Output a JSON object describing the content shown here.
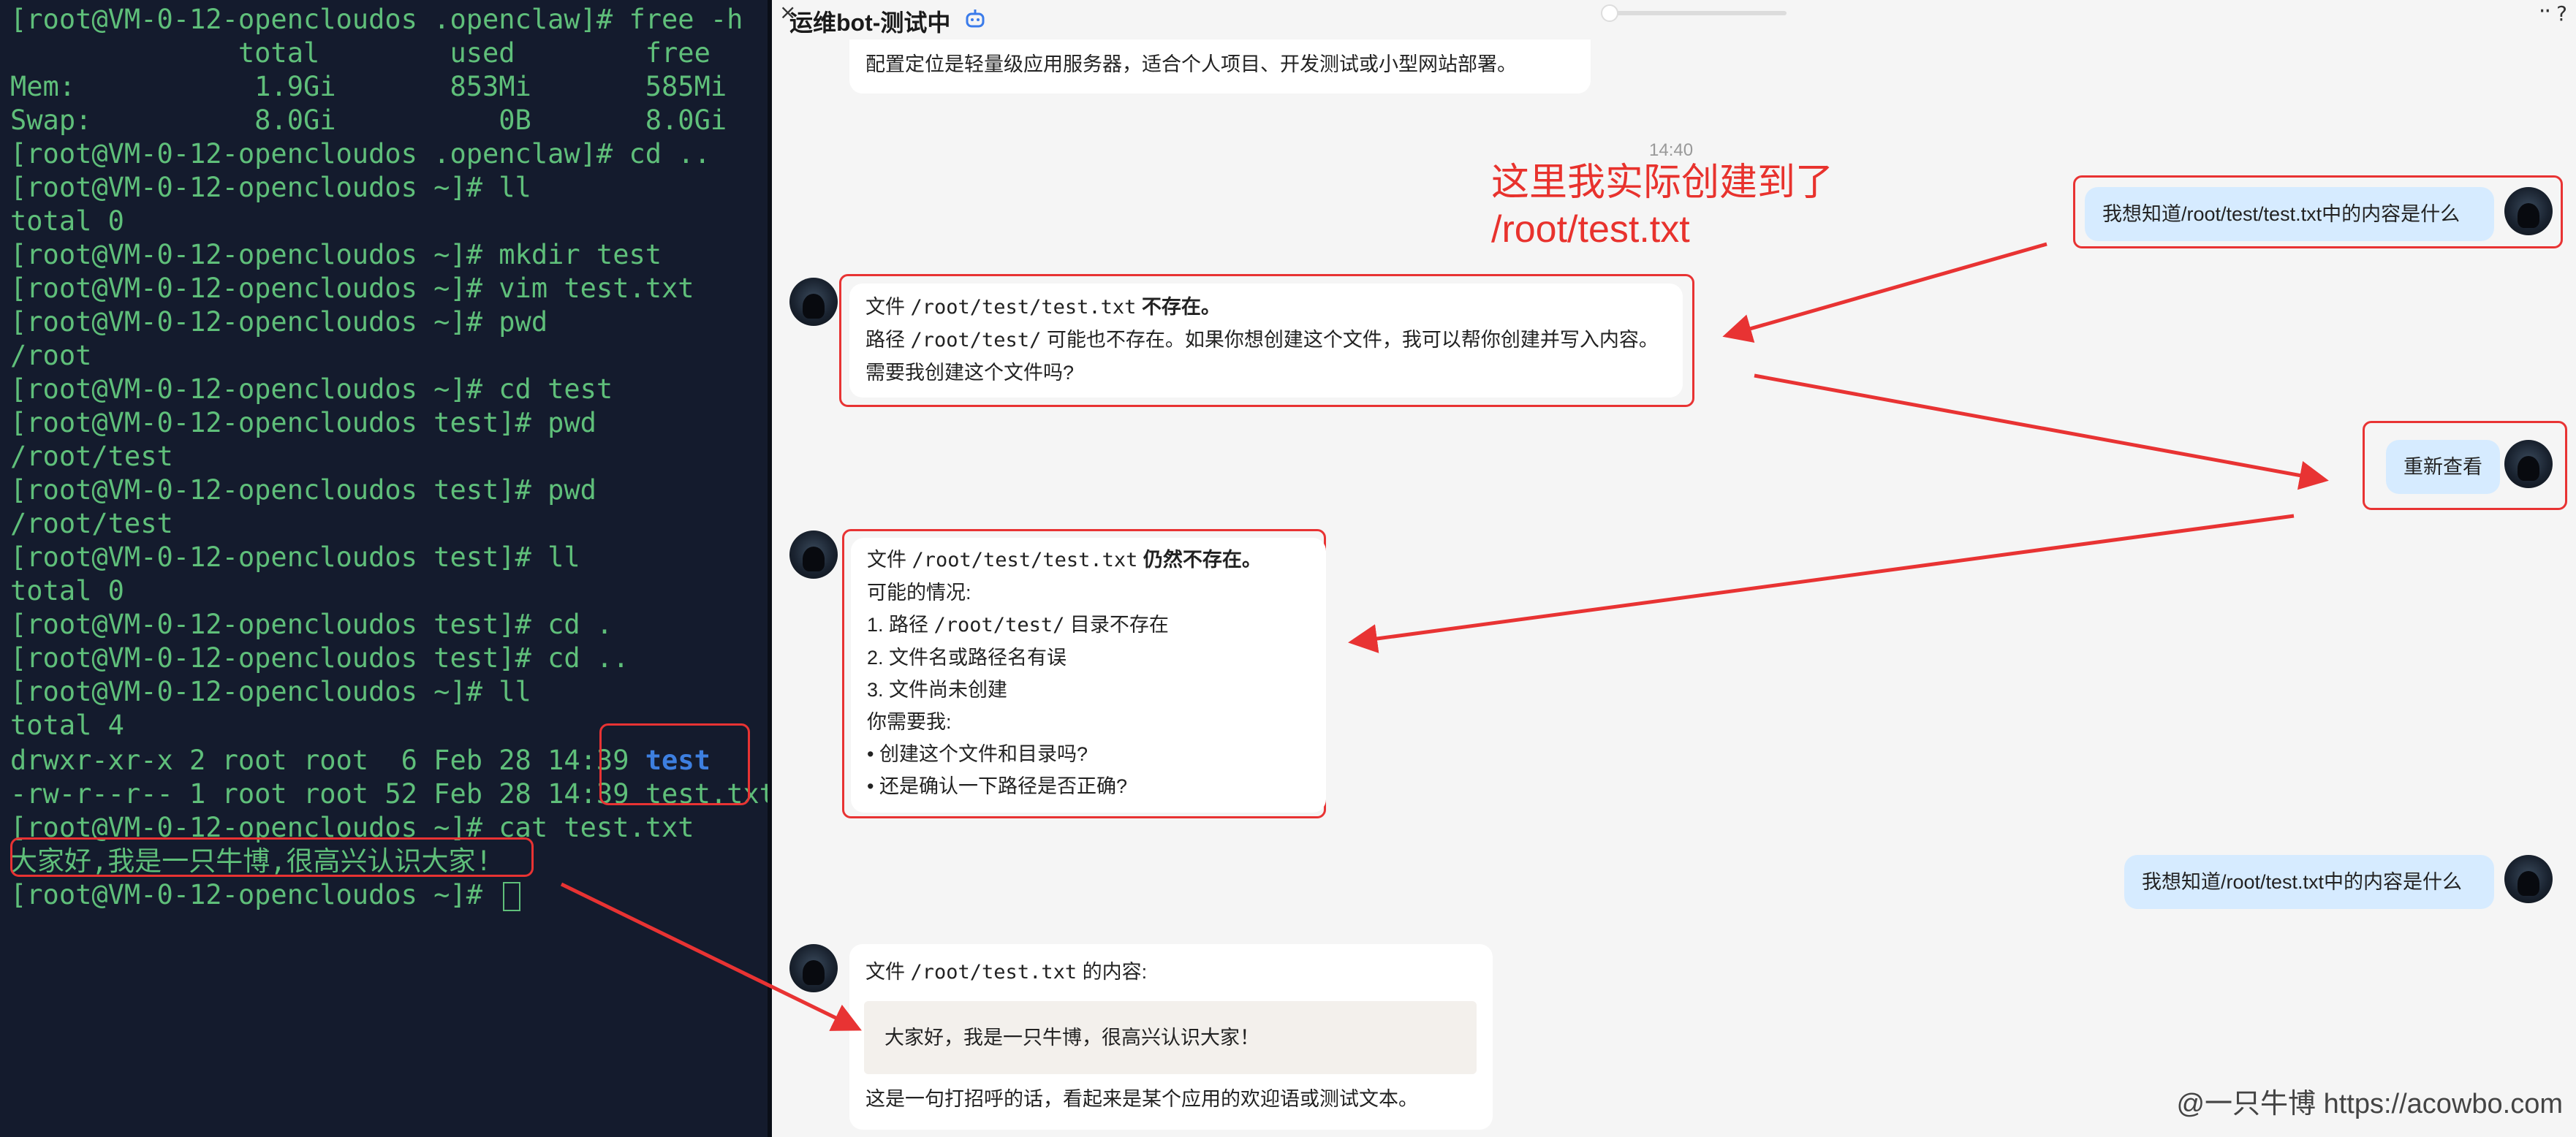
{
  "terminal": {
    "lines": [
      "[root@VM-0-12-opencloudos .openclaw]# free -h",
      "              total        used        free",
      "Mem:           1.9Gi       853Mi       585Mi",
      "Swap:          8.0Gi          0B       8.0Gi",
      "[root@VM-0-12-opencloudos .openclaw]# cd ..",
      "[root@VM-0-12-opencloudos ~]# ll",
      "total 0",
      "[root@VM-0-12-opencloudos ~]# mkdir test",
      "[root@VM-0-12-opencloudos ~]# vim test.txt",
      "[root@VM-0-12-opencloudos ~]# pwd",
      "/root",
      "[root@VM-0-12-opencloudos ~]# cd test",
      "[root@VM-0-12-opencloudos test]# pwd",
      "/root/test",
      "[root@VM-0-12-opencloudos test]# pwd",
      "/root/test",
      "[root@VM-0-12-opencloudos test]# ll",
      "total 0",
      "[root@VM-0-12-opencloudos test]# cd .",
      "[root@VM-0-12-opencloudos test]# cd ..",
      "[root@VM-0-12-opencloudos ~]# ll",
      "total 4"
    ],
    "ls_dir_prefix": "drwxr-xr-x 2 root root  6 Feb 28 14:39 ",
    "ls_dir_name": "test",
    "ls_file_prefix": "-rw-r--r-- 1 root root 52 Feb 28 14:39 ",
    "ls_file_name": "test.txt",
    "cat_cmd": "[root@VM-0-12-opencloudos ~]# cat test.txt",
    "cat_output": "大家好,我是一只牛博,很高兴认识大家!",
    "final_prompt": "[root@VM-0-12-opencloudos ~]# "
  },
  "chat": {
    "title": "运维bot-测试中",
    "close_glyph": "×",
    "more_glyph": "··",
    "help_glyph": "?",
    "top_partial": "配置定位是轻量级应用服务器，适合个人项目、开发测试或小型网站部署。",
    "timestamp": "14:40",
    "annotation_line1": "这里我实际创建到了",
    "annotation_line2": "/root/test.txt",
    "user_msg_1": "我想知道/root/test/test.txt中的内容是什么",
    "bot_msg_1": {
      "l1_pre": "文件 ",
      "l1_code": "/root/test/test.txt",
      "l1_bold": " 不存在。",
      "l2_pre": "路径 ",
      "l2_code": "/root/test/",
      "l2_post": " 可能也不存在。如果你想创建这个文件，我可以帮你创建并写入内容。",
      "l3": "需要我创建这个文件吗?"
    },
    "user_msg_2": "重新查看",
    "bot_msg_2": {
      "l1_pre": "文件 ",
      "l1_code": "/root/test/test.txt",
      "l1_bold": " 仍然不存在。",
      "l2": "可能的情况:",
      "l3_pre": "1. 路径 ",
      "l3_code": "/root/test/",
      "l3_post": " 目录不存在",
      "l4": "2. 文件名或路径名有误",
      "l5": "3. 文件尚未创建",
      "l6": "你需要我:",
      "l7": "• 创建这个文件和目录吗?",
      "l8": "• 还是确认一下路径是否正确?"
    },
    "user_msg_3": "我想知道/root/test.txt中的内容是什么",
    "bot_msg_3": {
      "l1_pre": "文件 ",
      "l1_code": "/root/test.txt",
      "l1_post": " 的内容:",
      "code": "大家好，我是一只牛博，很高兴认识大家！",
      "l3": "这是一句打招呼的话，看起来是某个应用的欢迎语或测试文本。"
    },
    "watermark": "@一只牛博 https://acowbo.com"
  },
  "colors": {
    "terminal_bg": "#141b2d",
    "terminal_fg": "#5fbf7a",
    "dir_color": "#3d7fe0",
    "annotation_red": "#e83333",
    "user_bubble": "#d6ebff"
  }
}
